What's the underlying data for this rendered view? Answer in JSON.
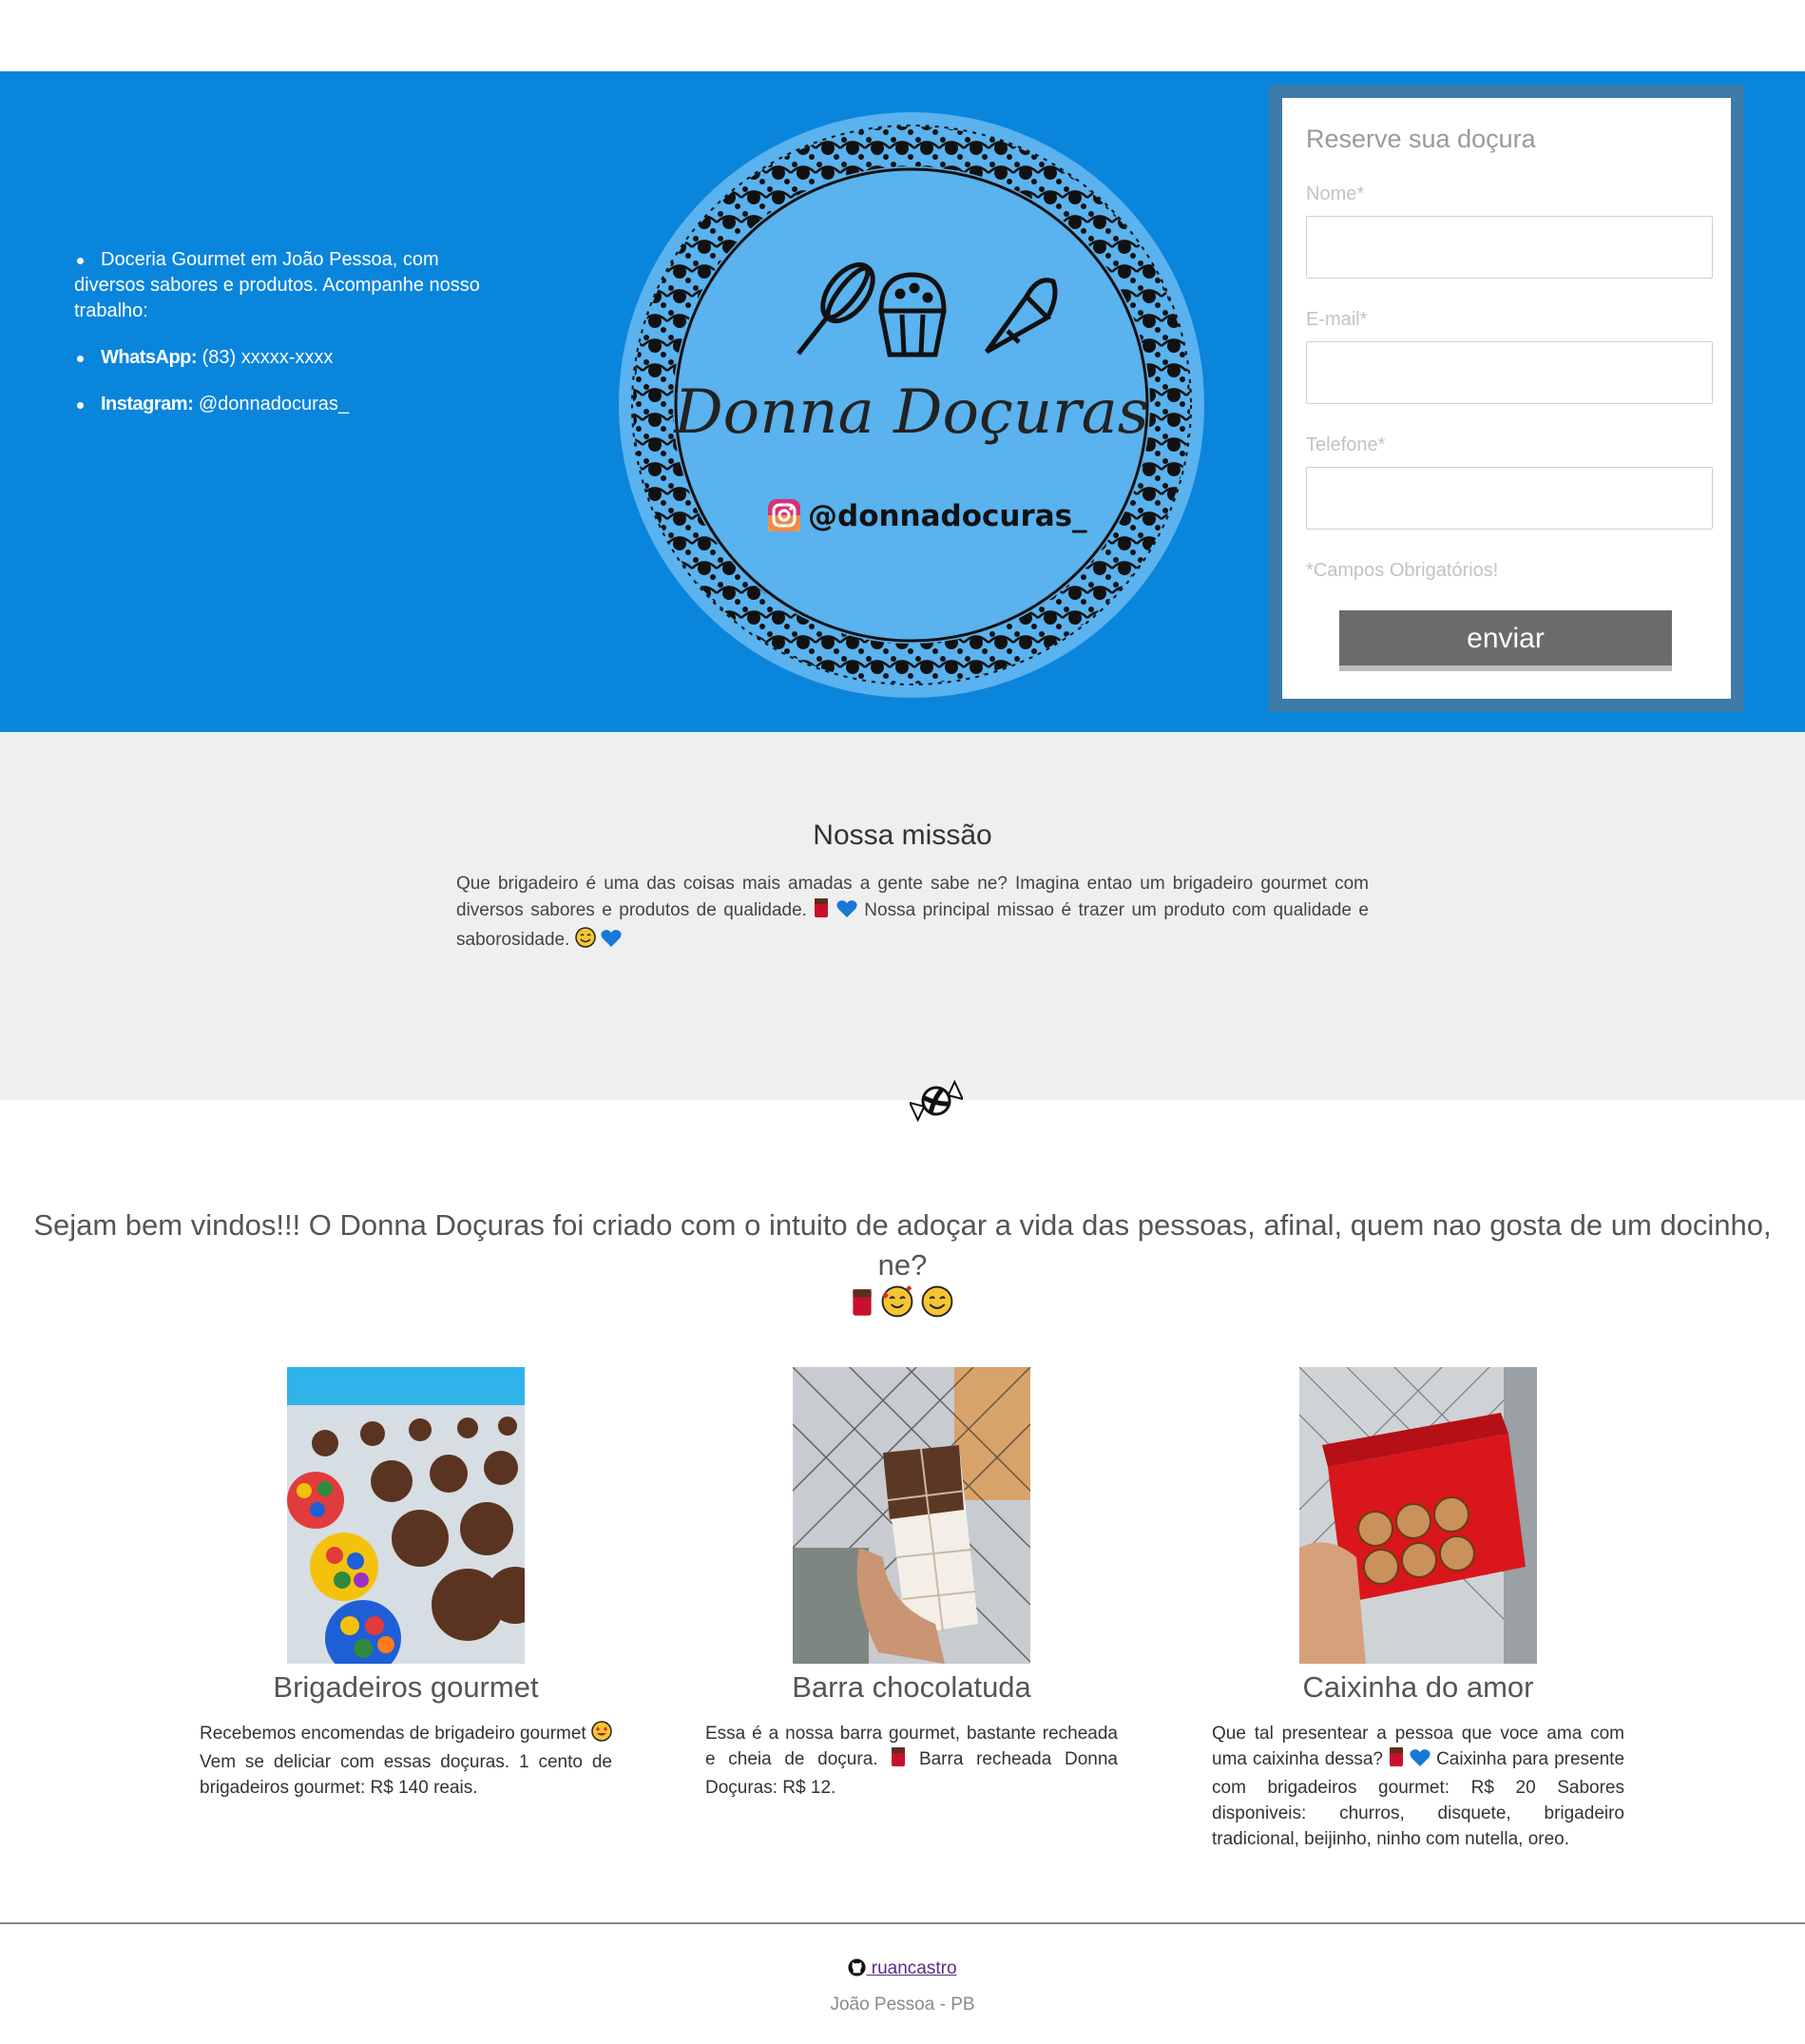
{
  "hero": {
    "info_intro": "Doceria Gourmet em João Pessoa, com diversos sabores e produtos. Acompanhe nosso trabalho:",
    "whatsapp_label": "WhatsApp:",
    "whatsapp_value": "(83) xxxxx-xxxx",
    "instagram_label": "Instagram:",
    "instagram_value": "@donnadocuras_",
    "logo_title": "Donna Doçuras",
    "logo_handle": "@donnadocuras_"
  },
  "form": {
    "title": "Reserve sua doçura",
    "name_label": "Nome*",
    "email_label": "E-mail*",
    "phone_label": "Telefone*",
    "required_note": "*Campos Obrigatórios!",
    "submit_label": "enviar"
  },
  "mission": {
    "title": "Nossa missão",
    "text_a": "Que brigadeiro é uma das coisas mais amadas a gente sabe ne? Imagina entao um brigadeiro gourmet com diversos sabores e produtos de qualidade.",
    "text_b": "Nossa principal missao é trazer um produto com qualidade e saborosidade."
  },
  "welcome": {
    "text": "Sejam bem vindos!!! O Donna Doçuras foi criado com o intuito de adoçar a vida das pessoas, afinal, quem nao gosta de um docinho, ne?"
  },
  "products": [
    {
      "title": "Brigadeiros gourmet",
      "text_a": "Recebemos encomendas de brigadeiro gourmet",
      "text_b": "Vem se deliciar com essas doçuras. 1 cento de brigadeiros gourmet: R$ 140 reais."
    },
    {
      "title": "Barra chocolatuda",
      "text_a": "Essa é a nossa barra gourmet, bastante recheada e cheia de doçura.",
      "text_b": "Barra recheada Donna Doçuras: R$ 12."
    },
    {
      "title": "Caixinha do amor",
      "text_a": "Que tal presentear a pessoa que voce ama com uma caixinha dessa?",
      "text_b": "Caixinha para presente com brigadeiros gourmet: R$ 20 Sabores disponiveis: churros, disquete, brigadeiro tradicional, beijinho, ninho com nutella, oreo."
    }
  ],
  "footer": {
    "github_user": " ruancastro",
    "city": "João Pessoa - PB"
  },
  "colors": {
    "hero_blue": "#0a85dc",
    "logo_circle": "#5ab2ee",
    "form_frame": "#3d7ba8",
    "button_gray": "#6b6b6b",
    "mission_bg": "#efefef"
  },
  "icons": [
    "whisk-icon",
    "cupcake-icon",
    "piping-bag-icon",
    "instagram-icon",
    "candy-icon",
    "github-icon",
    "chocolate-bar-emoji",
    "blue-heart-emoji",
    "smiling-face-emoji",
    "heart-eyes-emoji",
    "smiling-hearts-emoji"
  ]
}
